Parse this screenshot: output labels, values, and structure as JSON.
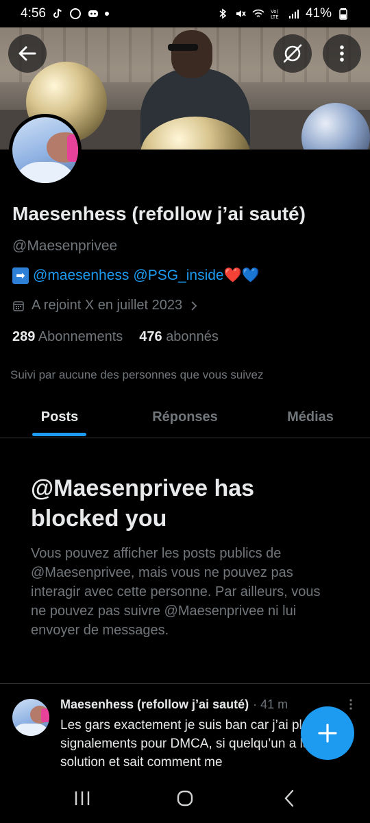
{
  "status_bar": {
    "time": "4:56",
    "battery": "41%"
  },
  "profile": {
    "display_name": "Maesenhess (refollow j’ai sauté)",
    "handle": "@Maesenprivee",
    "bio": {
      "arrow": "➡",
      "mention1": "@maesenhess",
      "mention2": "@PSG_inside",
      "hearts": "❤️💙"
    },
    "joined": "A rejoint X en juillet 2023",
    "following_count": "289",
    "following_label": "Abonnements",
    "followers_count": "476",
    "followers_label": "abonnés",
    "followed_by": "Suivi par aucune des personnes que vous suivez"
  },
  "tabs": [
    {
      "label": "Posts",
      "active": true
    },
    {
      "label": "Réponses",
      "active": false
    },
    {
      "label": "Médias",
      "active": false
    }
  ],
  "blocked": {
    "title": "@Maesenprivee has blocked you",
    "text": "Vous pouvez afficher les posts publics de @Maesenprivee, mais vous ne pouvez pas interagir avec cette personne. Par ailleurs, vous ne pouvez pas suivre @Maesenprivee ni lui envoyer de messages."
  },
  "post": {
    "author": "Maesenhess (refollow j’ai sauté)",
    "time": "· 41 m",
    "text": "Les gars exactement je suis ban car j’ai plusieurs signalements pour DMCA, si quelqu’un a la solution et sait comment me"
  },
  "colors": {
    "accent": "#1d9bf0",
    "background": "#000000",
    "muted": "#71767b"
  },
  "icons": [
    "back-arrow-icon",
    "grok-icon",
    "more-vertical-icon",
    "calendar-icon",
    "chevron-right-icon",
    "plus-icon",
    "recents-icon",
    "home-icon",
    "back-icon"
  ]
}
